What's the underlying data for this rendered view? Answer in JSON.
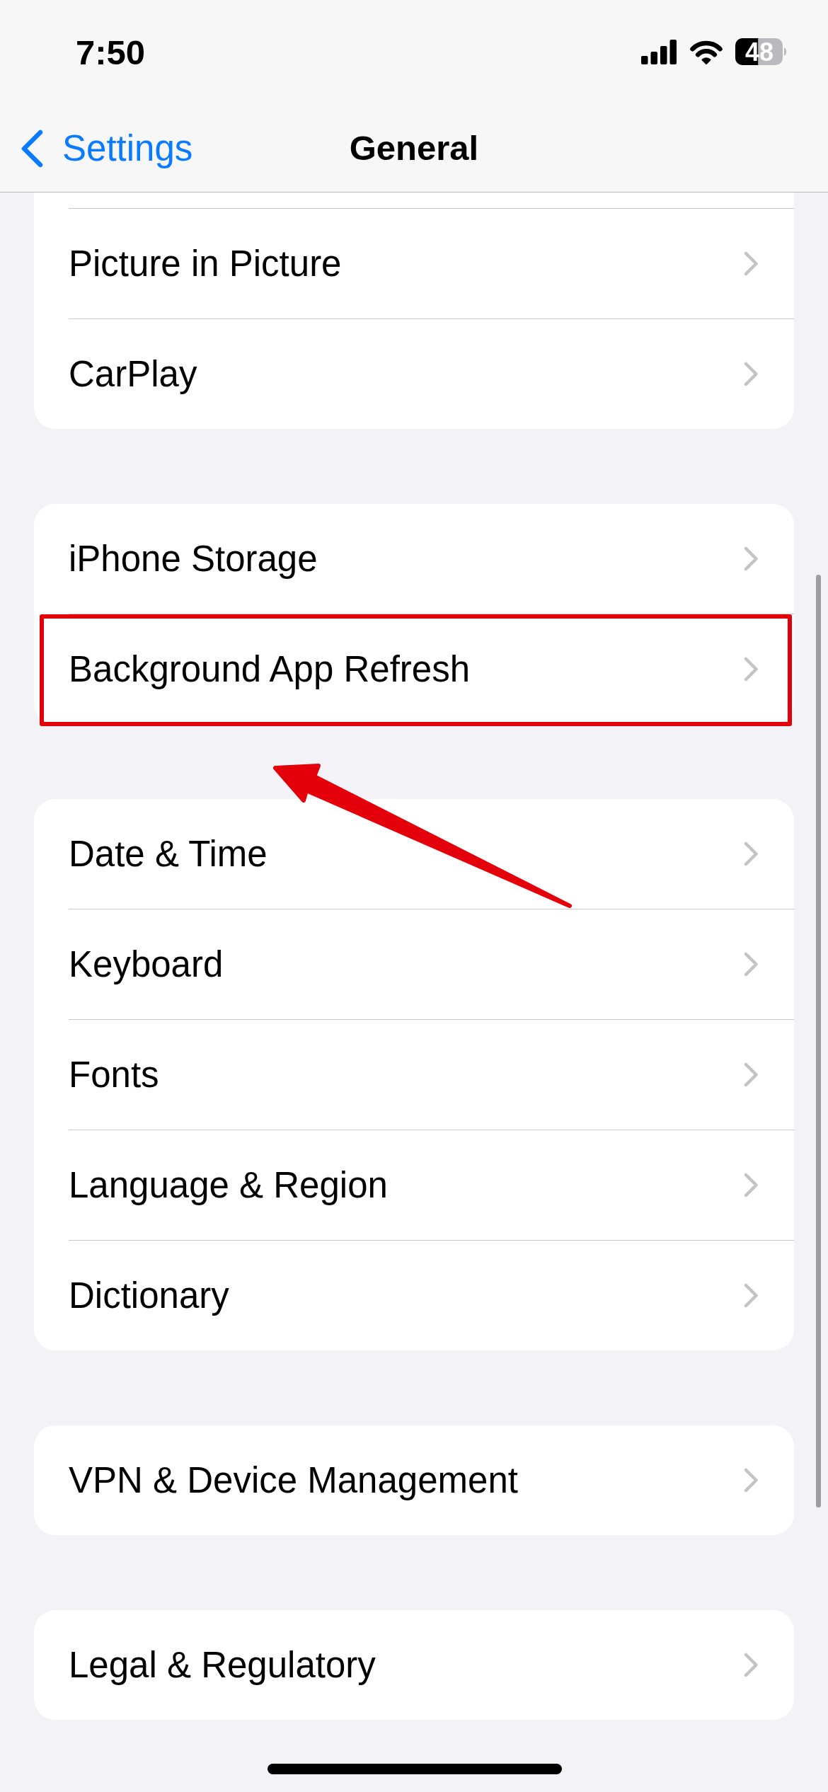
{
  "status_bar": {
    "time": "7:50",
    "battery": "48"
  },
  "nav_bar": {
    "back_label": "Settings",
    "title": "General"
  },
  "groups": [
    {
      "cut_at_top": true,
      "rows": [
        {
          "label": "Picture in Picture",
          "highlighted": false
        },
        {
          "label": "CarPlay",
          "highlighted": false
        }
      ]
    },
    {
      "cut_at_top": false,
      "rows": [
        {
          "label": "iPhone Storage",
          "highlighted": false
        },
        {
          "label": "Background App Refresh",
          "highlighted": true
        }
      ]
    },
    {
      "cut_at_top": false,
      "rows": [
        {
          "label": "Date & Time",
          "highlighted": false
        },
        {
          "label": "Keyboard",
          "highlighted": false
        },
        {
          "label": "Fonts",
          "highlighted": false
        },
        {
          "label": "Language & Region",
          "highlighted": false
        },
        {
          "label": "Dictionary",
          "highlighted": false
        }
      ]
    },
    {
      "cut_at_top": false,
      "rows": [
        {
          "label": "VPN & Device Management",
          "highlighted": false
        }
      ]
    },
    {
      "cut_at_top": false,
      "rows": [
        {
          "label": "Legal & Regulatory",
          "highlighted": false
        }
      ]
    }
  ],
  "annotation": {
    "arrow": true
  }
}
